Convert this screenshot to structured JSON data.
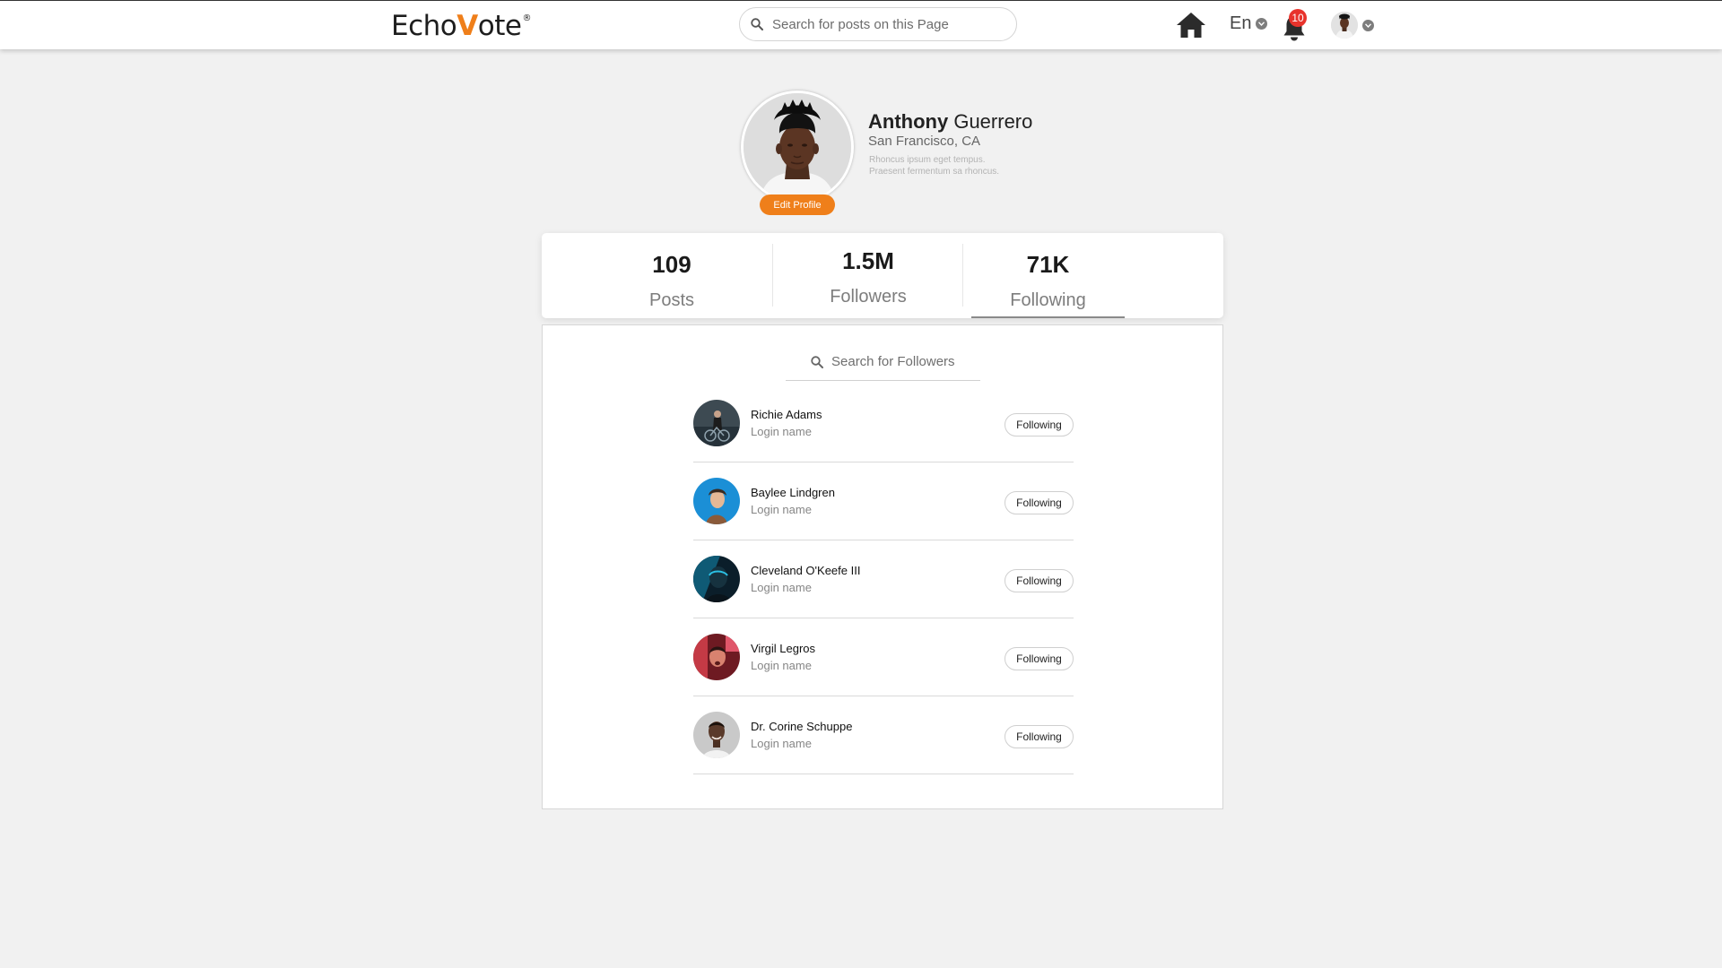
{
  "header": {
    "logo": {
      "pre": "Echo",
      "check": "V",
      "post": "ote",
      "reg": "®"
    },
    "search_placeholder": "Search for posts on this Page",
    "language": "En",
    "notification_count": "10"
  },
  "profile": {
    "first_name": "Anthony",
    "last_name": "Guerrero",
    "location": "San Francisco, CA",
    "bio_line1": "Rhoncus ipsum eget tempus.",
    "bio_line2": "Praesent fermentum sa  rhoncus.",
    "edit_label": "Edit Profile"
  },
  "stats": [
    {
      "value": "109",
      "label": "Posts"
    },
    {
      "value": "1.5M",
      "label": "Followers"
    },
    {
      "value": "71K",
      "label": "Following",
      "active": true
    }
  ],
  "followers_panel": {
    "search_placeholder": "Search for Followers",
    "items": [
      {
        "name": "Richie Adams",
        "login": "Login name",
        "button": "Following"
      },
      {
        "name": "Baylee Lindgren",
        "login": "Login name",
        "button": "Following"
      },
      {
        "name": "Cleveland O'Keefe III",
        "login": "Login name",
        "button": "Following"
      },
      {
        "name": "Virgil Legros",
        "login": "Login name",
        "button": "Following"
      },
      {
        "name": "Dr. Corine Schuppe",
        "login": "Login name",
        "button": "Following"
      }
    ]
  },
  "colors": {
    "brand_orange": "#ef7f1a",
    "badge_red": "#e8332c",
    "page_bg": "#f1f1f1"
  },
  "icons": [
    "search-icon",
    "home-icon",
    "chevron-down-icon",
    "bell-icon",
    "avatar"
  ]
}
